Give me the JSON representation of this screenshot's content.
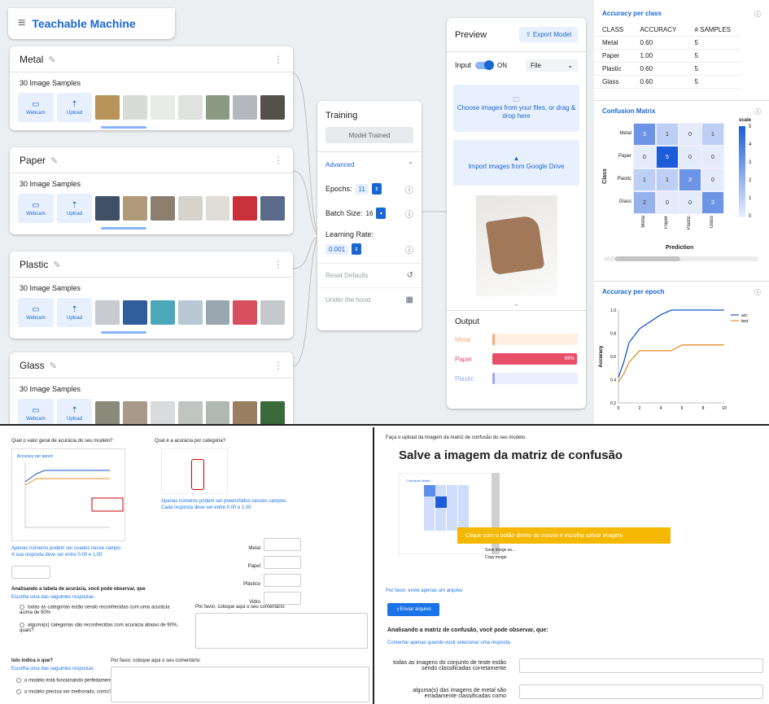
{
  "app": {
    "title": "Teachable Machine"
  },
  "classes": [
    {
      "name": "Metal",
      "samples": "30 Image Samples",
      "webcam": "Webcam",
      "upload": "Upload"
    },
    {
      "name": "Paper",
      "samples": "30 Image Samples",
      "webcam": "Webcam",
      "upload": "Upload"
    },
    {
      "name": "Plastic",
      "samples": "30 Image Samples",
      "webcam": "Webcam",
      "upload": "Upload"
    },
    {
      "name": "Glass",
      "samples": "30 Image Samples",
      "webcam": "Webcam",
      "upload": "Upload"
    }
  ],
  "training": {
    "title": "Training",
    "status": "Model Trained",
    "advanced": "Advanced",
    "epochs_label": "Epochs:",
    "epochs": "11",
    "batch_label": "Batch Size:",
    "batch": "16",
    "lr_label": "Learning Rate:",
    "lr": "0.001",
    "reset": "Reset Defaults",
    "under_hood": "Under the hood"
  },
  "preview": {
    "title": "Preview",
    "export": "Export Model",
    "input": "Input",
    "on": "ON",
    "file": "File",
    "choose": "Choose images from your files, or drag & drop here",
    "drive": "Import images from Google Drive",
    "output": "Output",
    "outputs": [
      {
        "label": "Metal",
        "pct": "",
        "value": 0,
        "color": "#f9a97a"
      },
      {
        "label": "Paper",
        "pct": "99%",
        "value": 0.99,
        "color": "#e8506a"
      },
      {
        "label": "Plastic",
        "pct": "",
        "value": 0,
        "color": "#9aa8f5"
      }
    ]
  },
  "accuracy_per_class": {
    "title": "Accuracy per class",
    "headers": [
      "CLASS",
      "ACCURACY",
      "# SAMPLES"
    ],
    "rows": [
      [
        "Metal",
        "0.60",
        "5"
      ],
      [
        "Paper",
        "1.00",
        "5"
      ],
      [
        "Plastic",
        "0.60",
        "5"
      ],
      [
        "Glass",
        "0.60",
        "5"
      ]
    ]
  },
  "confusion": {
    "title": "Confusion Matrix",
    "ylabel": "Class",
    "xlabel": "Prediction",
    "scale_label": "scale",
    "rows": [
      "Metal",
      "Paper",
      "Plastic",
      "Glass"
    ],
    "cols": [
      "Metal",
      "Paper",
      "Plastic",
      "Glass"
    ],
    "matrix": [
      [
        3,
        1,
        0,
        1
      ],
      [
        0,
        5,
        0,
        0
      ],
      [
        1,
        1,
        3,
        0
      ],
      [
        2,
        0,
        0,
        3
      ]
    ],
    "scale_ticks": [
      "5",
      "4",
      "3",
      "2",
      "1",
      "0"
    ]
  },
  "chart_data": {
    "type": "line",
    "title": "Accuracy per epoch",
    "ylabel": "Accuracy",
    "xlim": [
      0,
      10
    ],
    "ylim": [
      0.2,
      1.0
    ],
    "xticks": [
      "0",
      "2",
      "4",
      "6",
      "8",
      "10"
    ],
    "yticks": [
      "1.0",
      "0.8",
      "0.6",
      "0.4",
      "0.2"
    ],
    "series": [
      {
        "name": "acc",
        "color": "#1a56c9",
        "x": [
          0,
          0.5,
          1,
          2,
          3,
          4,
          5,
          6,
          7,
          8,
          9,
          10
        ],
        "y": [
          0.42,
          0.55,
          0.72,
          0.84,
          0.9,
          0.96,
          1.0,
          1.0,
          1.0,
          1.0,
          1.0,
          1.0
        ]
      },
      {
        "name": "test",
        "color": "#e8902a",
        "x": [
          0,
          0.5,
          1,
          2,
          3,
          4,
          5,
          6,
          7,
          8,
          9,
          10
        ],
        "y": [
          0.38,
          0.45,
          0.55,
          0.65,
          0.65,
          0.65,
          0.65,
          0.7,
          0.7,
          0.7,
          0.7,
          0.7
        ]
      }
    ]
  },
  "form_left": {
    "q1": "Qual o valor geral de acurácia do seu modelo?",
    "q2": "Qual é a acurácia por categoria?",
    "note_only_numbers": "Apenas números podem ser usados nesse campo.",
    "note_range": "A sua resposta deve ser entre 0.00 e 1.00",
    "note_fill": "Apenas números podem ser preenchidos nesses campos.",
    "note_range2": "Cada resposta deve ser entre 0.00 e 1.00",
    "labels": [
      "Metal",
      "Papel",
      "Plástico",
      "Vidro"
    ],
    "q3": "Analisando a tabela de acurácia, você pode observar, que",
    "choose_one": "Escolha uma das seguintes respostas",
    "opt1": "todas as categorias estão sendo reconhecidas com uma acurácia acima de 90%",
    "opt2": "alguma(s) categorias são reconhecidas com acurácia abaixo de 90%, quais?",
    "comment": "Por favor, coloque aqui o seu comentário:",
    "q4": "Isto indica o que?",
    "choose_one2": "Escolha uma das seguintes respostas",
    "comment2": "Por favor, coloque aqui o seu comentário:",
    "opt3": "o modelo está funcionando perfeitamente",
    "opt4": "o modelo precisa ser melhorado, como?"
  },
  "form_right": {
    "intro": "Faça o upload da imagem da matriz de confusão do seu modelo.",
    "heading": "Salve a imagem da matriz de confusão",
    "tooltip": "Clique com o botão direito do mouse e escolha salvar imagem",
    "save_img": "Save image as...",
    "copy_img": "Copy image",
    "note_one_file": "Por favor, envie apenas um arquivo",
    "upload_btn": "Enviar arquivo",
    "q": "Analisando a matriz de confusão, você pode observar, que:",
    "note_comment": "Comentar apenas quando você selecionar uma resposta.",
    "opt1": "todas as imagens do conjunto de teste estão sendo classificadas corretamente",
    "opt2": "alguma(s) das imagens de metal são erradamente classificadas como"
  }
}
